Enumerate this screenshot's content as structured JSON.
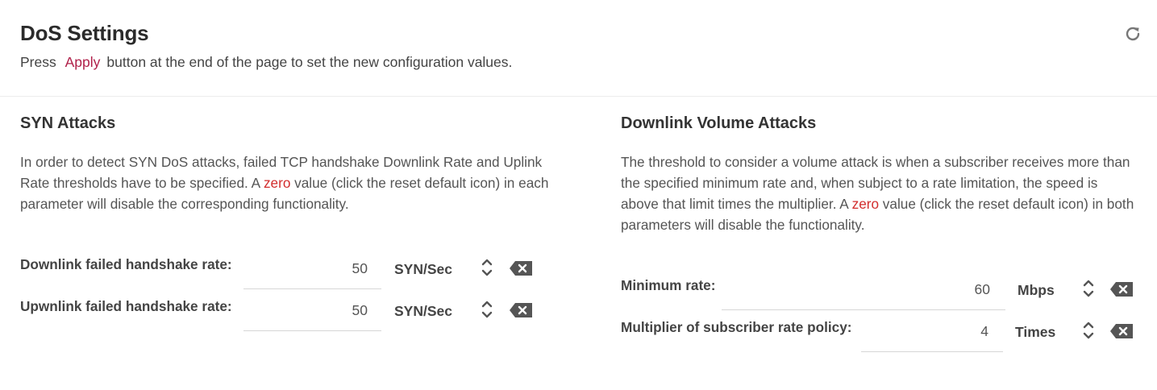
{
  "header": {
    "title": "DoS Settings",
    "subtitle_prefix": "Press",
    "subtitle_link": "Apply",
    "subtitle_suffix": "button at the end of the page to set the new configuration values."
  },
  "syn": {
    "title": "SYN Attacks",
    "desc_part1": "In order to detect SYN DoS attacks, failed TCP handshake Downlink Rate and Uplink Rate thresholds have to be specified. A ",
    "desc_zero": "zero",
    "desc_part2": " value (click the reset default icon) in each parameter will disable the corresponding functionality.",
    "fields": [
      {
        "label": "Downlink failed handshake rate:",
        "value": "50",
        "unit": "SYN/Sec"
      },
      {
        "label": "Upwnlink failed handshake rate:",
        "value": "50",
        "unit": "SYN/Sec"
      }
    ]
  },
  "volume": {
    "title": "Downlink Volume Attacks",
    "desc_part1": "The threshold to consider a volume attack is when a subscriber receives more than the specified minimum rate and, when subject to a rate limitation, the speed is above that limit times the multiplier. A ",
    "desc_zero": "zero",
    "desc_part2": " value (click the reset default icon) in both parameters will disable the functionality.",
    "fields": [
      {
        "label": "Minimum rate:",
        "value": "60",
        "unit": "Mbps"
      },
      {
        "label": "Multiplier of subscriber rate policy:",
        "value": "4",
        "unit": "Times"
      }
    ]
  },
  "colors": {
    "accent": "#b0214a",
    "zero": "#d22d2d",
    "icon": "#555555"
  },
  "icons": {
    "refresh": "refresh-icon",
    "stepper": "stepper-icon",
    "clear": "clear-icon"
  }
}
